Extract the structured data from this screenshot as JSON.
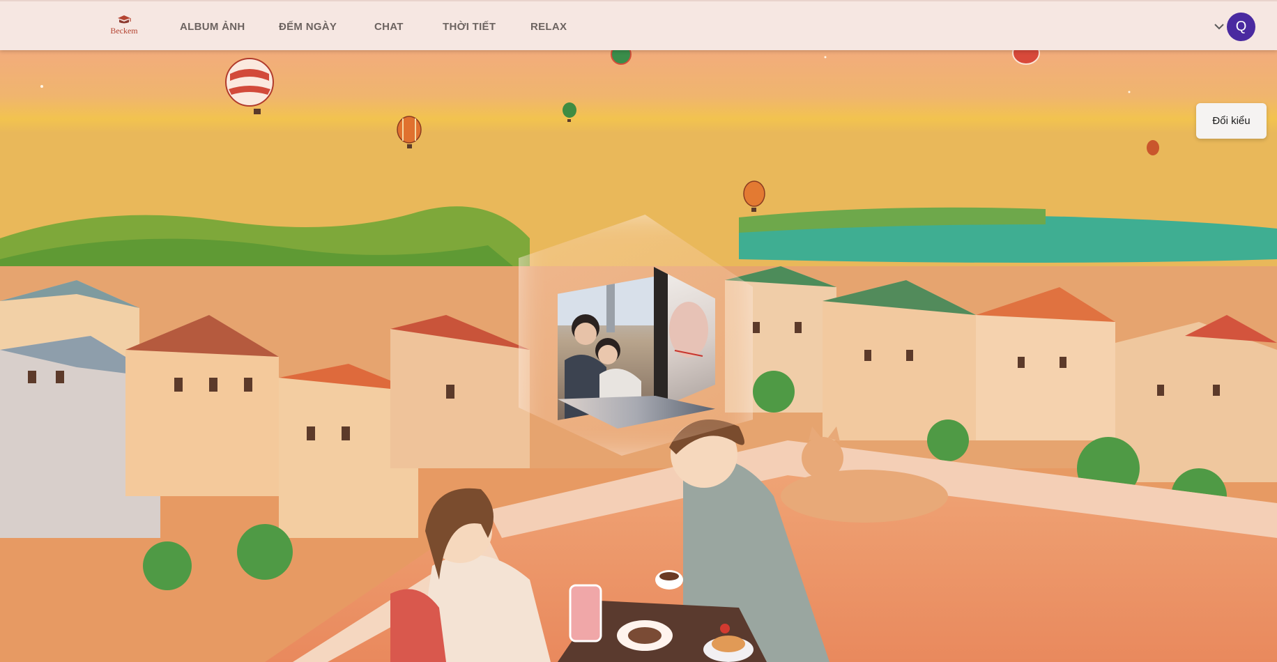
{
  "header": {
    "logo_text": "Beckem",
    "nav": [
      "ALBUM ẢNH",
      "ĐẾM NGÀY",
      "CHAT",
      "THỜI TIẾT",
      "RELAX"
    ],
    "avatar_initial": "Q"
  },
  "main": {
    "switch_style_label": "Đổi kiểu"
  },
  "colors": {
    "header_bg": "#f6e7e2",
    "nav_text": "#6c6360",
    "avatar_bg": "#4a2aa0",
    "logo_red": "#b44432"
  }
}
